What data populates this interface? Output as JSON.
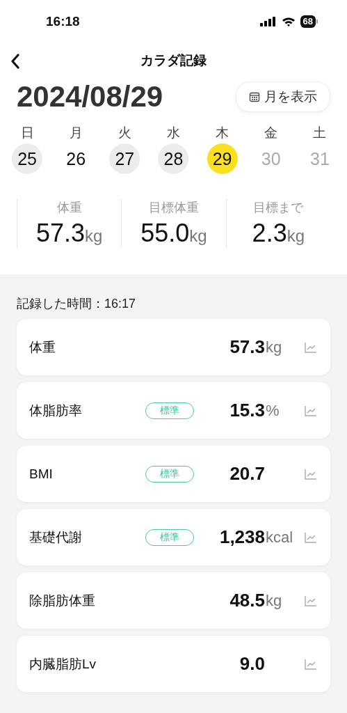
{
  "status_bar": {
    "time": "16:18",
    "battery": "68"
  },
  "header": {
    "title": "カラダ記録"
  },
  "date": {
    "text": "2024/08/29",
    "month_button": "月を表示"
  },
  "week": [
    {
      "weekday": "日",
      "day": "25",
      "recorded": true,
      "selected": false,
      "disabled": false
    },
    {
      "weekday": "月",
      "day": "26",
      "recorded": false,
      "selected": false,
      "disabled": false
    },
    {
      "weekday": "火",
      "day": "27",
      "recorded": true,
      "selected": false,
      "disabled": false
    },
    {
      "weekday": "水",
      "day": "28",
      "recorded": true,
      "selected": false,
      "disabled": false
    },
    {
      "weekday": "木",
      "day": "29",
      "recorded": true,
      "selected": true,
      "disabled": false
    },
    {
      "weekday": "金",
      "day": "30",
      "recorded": false,
      "selected": false,
      "disabled": true
    },
    {
      "weekday": "土",
      "day": "31",
      "recorded": false,
      "selected": false,
      "disabled": true
    }
  ],
  "summary": [
    {
      "label": "体重",
      "value": "57.3",
      "unit": "kg"
    },
    {
      "label": "目標体重",
      "value": "55.0",
      "unit": "kg"
    },
    {
      "label": "目標まで",
      "value": "2.3",
      "unit": "kg"
    }
  ],
  "recorded_time": "記録した時間：16:17",
  "records": [
    {
      "label": "体重",
      "value": "57.3",
      "unit": "kg"
    },
    {
      "label": "体脂肪率",
      "badge": "標準",
      "value": "15.3",
      "unit": "%"
    },
    {
      "label": "BMI",
      "badge": "標準",
      "value": "20.7"
    },
    {
      "label": "基礎代謝",
      "badge": "標準",
      "value": "1,238",
      "unit": "kcal"
    },
    {
      "label": "除脂肪体重",
      "value": "48.5",
      "unit": "kg"
    },
    {
      "label": "内臓脂肪Lv",
      "value": "9.0"
    }
  ]
}
